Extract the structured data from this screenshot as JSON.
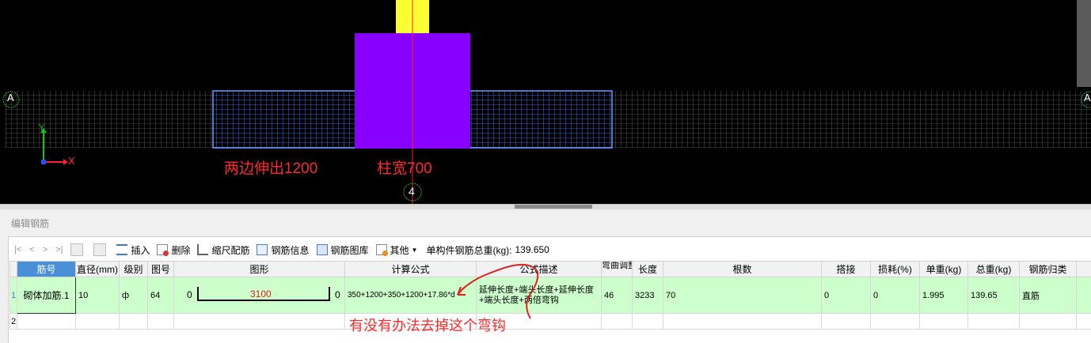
{
  "viewport": {
    "axis_top_left": "A",
    "axis_top_right": "A",
    "axis_bottom": "4",
    "axis_x_label": "X",
    "axis_y_label": "Y",
    "annotation_extend": "两边伸出1200",
    "annotation_column_width": "柱宽700",
    "colors": {
      "background": "#000000",
      "column": "#8800ff",
      "column_top": "#ffff33",
      "beam_outline": "#4a8cff",
      "axis_line": "#ff2020",
      "annotation": "#ff2a2a"
    }
  },
  "panel": {
    "title": "编辑钢筋",
    "toolbar": {
      "nav": [
        "|<",
        "<",
        ">",
        ">|"
      ],
      "insert": "插入",
      "delete": "删除",
      "scale_config": "缩尺配筋",
      "rebar_info": "钢筋信息",
      "rebar_library": "钢筋图库",
      "other": "其他",
      "total_weight_label": "单构件钢筋总重(kg):",
      "total_weight_value": "139.650"
    },
    "columns": [
      "筋号",
      "直径(mm)",
      "级别",
      "图号",
      "图形",
      "计算公式",
      "公式描述",
      "弯曲调整",
      "长度",
      "根数",
      "搭接",
      "损耗(%)",
      "单重(kg)",
      "总重(kg)",
      "钢筋归类"
    ],
    "rows": [
      {
        "row_num": "1",
        "name": "砌体加筋.1",
        "diameter": "10",
        "grade": "ф",
        "figure_no": "64",
        "shape_left": "0",
        "shape_mid": "3100",
        "shape_right": "0",
        "formula": "350+1200+350+1200+17.86*d",
        "formula_desc": "延伸长度+端头长度+延伸长度+端头长度+两倍弯钩",
        "bend_adjust": "46",
        "length": "3233",
        "count": "70",
        "overlap": "0",
        "loss": "0",
        "unit_weight": "1.995",
        "total_weight": "139.65",
        "category": "直筋"
      },
      {
        "row_num": "2"
      }
    ]
  },
  "annotation": "有没有办法去掉这个弯钩"
}
